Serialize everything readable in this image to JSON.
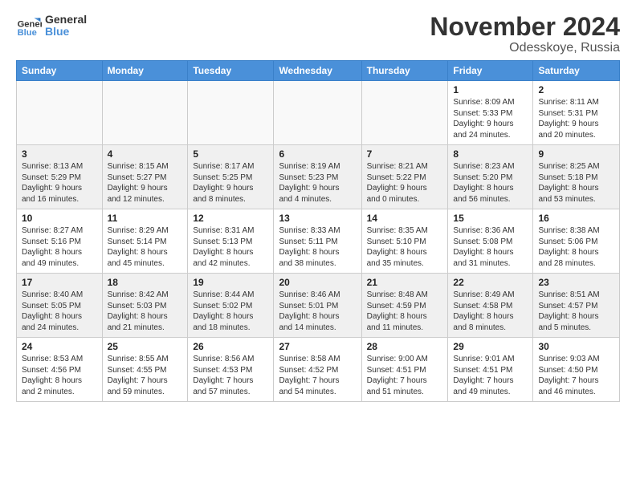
{
  "header": {
    "logo_general": "General",
    "logo_blue": "Blue",
    "title": "November 2024",
    "subtitle": "Odesskoye, Russia"
  },
  "days_of_week": [
    "Sunday",
    "Monday",
    "Tuesday",
    "Wednesday",
    "Thursday",
    "Friday",
    "Saturday"
  ],
  "weeks": [
    [
      {
        "day": "",
        "info": ""
      },
      {
        "day": "",
        "info": ""
      },
      {
        "day": "",
        "info": ""
      },
      {
        "day": "",
        "info": ""
      },
      {
        "day": "",
        "info": ""
      },
      {
        "day": "1",
        "info": "Sunrise: 8:09 AM\nSunset: 5:33 PM\nDaylight: 9 hours\nand 24 minutes."
      },
      {
        "day": "2",
        "info": "Sunrise: 8:11 AM\nSunset: 5:31 PM\nDaylight: 9 hours\nand 20 minutes."
      }
    ],
    [
      {
        "day": "3",
        "info": "Sunrise: 8:13 AM\nSunset: 5:29 PM\nDaylight: 9 hours\nand 16 minutes."
      },
      {
        "day": "4",
        "info": "Sunrise: 8:15 AM\nSunset: 5:27 PM\nDaylight: 9 hours\nand 12 minutes."
      },
      {
        "day": "5",
        "info": "Sunrise: 8:17 AM\nSunset: 5:25 PM\nDaylight: 9 hours\nand 8 minutes."
      },
      {
        "day": "6",
        "info": "Sunrise: 8:19 AM\nSunset: 5:23 PM\nDaylight: 9 hours\nand 4 minutes."
      },
      {
        "day": "7",
        "info": "Sunrise: 8:21 AM\nSunset: 5:22 PM\nDaylight: 9 hours\nand 0 minutes."
      },
      {
        "day": "8",
        "info": "Sunrise: 8:23 AM\nSunset: 5:20 PM\nDaylight: 8 hours\nand 56 minutes."
      },
      {
        "day": "9",
        "info": "Sunrise: 8:25 AM\nSunset: 5:18 PM\nDaylight: 8 hours\nand 53 minutes."
      }
    ],
    [
      {
        "day": "10",
        "info": "Sunrise: 8:27 AM\nSunset: 5:16 PM\nDaylight: 8 hours\nand 49 minutes."
      },
      {
        "day": "11",
        "info": "Sunrise: 8:29 AM\nSunset: 5:14 PM\nDaylight: 8 hours\nand 45 minutes."
      },
      {
        "day": "12",
        "info": "Sunrise: 8:31 AM\nSunset: 5:13 PM\nDaylight: 8 hours\nand 42 minutes."
      },
      {
        "day": "13",
        "info": "Sunrise: 8:33 AM\nSunset: 5:11 PM\nDaylight: 8 hours\nand 38 minutes."
      },
      {
        "day": "14",
        "info": "Sunrise: 8:35 AM\nSunset: 5:10 PM\nDaylight: 8 hours\nand 35 minutes."
      },
      {
        "day": "15",
        "info": "Sunrise: 8:36 AM\nSunset: 5:08 PM\nDaylight: 8 hours\nand 31 minutes."
      },
      {
        "day": "16",
        "info": "Sunrise: 8:38 AM\nSunset: 5:06 PM\nDaylight: 8 hours\nand 28 minutes."
      }
    ],
    [
      {
        "day": "17",
        "info": "Sunrise: 8:40 AM\nSunset: 5:05 PM\nDaylight: 8 hours\nand 24 minutes."
      },
      {
        "day": "18",
        "info": "Sunrise: 8:42 AM\nSunset: 5:03 PM\nDaylight: 8 hours\nand 21 minutes."
      },
      {
        "day": "19",
        "info": "Sunrise: 8:44 AM\nSunset: 5:02 PM\nDaylight: 8 hours\nand 18 minutes."
      },
      {
        "day": "20",
        "info": "Sunrise: 8:46 AM\nSunset: 5:01 PM\nDaylight: 8 hours\nand 14 minutes."
      },
      {
        "day": "21",
        "info": "Sunrise: 8:48 AM\nSunset: 4:59 PM\nDaylight: 8 hours\nand 11 minutes."
      },
      {
        "day": "22",
        "info": "Sunrise: 8:49 AM\nSunset: 4:58 PM\nDaylight: 8 hours\nand 8 minutes."
      },
      {
        "day": "23",
        "info": "Sunrise: 8:51 AM\nSunset: 4:57 PM\nDaylight: 8 hours\nand 5 minutes."
      }
    ],
    [
      {
        "day": "24",
        "info": "Sunrise: 8:53 AM\nSunset: 4:56 PM\nDaylight: 8 hours\nand 2 minutes."
      },
      {
        "day": "25",
        "info": "Sunrise: 8:55 AM\nSunset: 4:55 PM\nDaylight: 7 hours\nand 59 minutes."
      },
      {
        "day": "26",
        "info": "Sunrise: 8:56 AM\nSunset: 4:53 PM\nDaylight: 7 hours\nand 57 minutes."
      },
      {
        "day": "27",
        "info": "Sunrise: 8:58 AM\nSunset: 4:52 PM\nDaylight: 7 hours\nand 54 minutes."
      },
      {
        "day": "28",
        "info": "Sunrise: 9:00 AM\nSunset: 4:51 PM\nDaylight: 7 hours\nand 51 minutes."
      },
      {
        "day": "29",
        "info": "Sunrise: 9:01 AM\nSunset: 4:51 PM\nDaylight: 7 hours\nand 49 minutes."
      },
      {
        "day": "30",
        "info": "Sunrise: 9:03 AM\nSunset: 4:50 PM\nDaylight: 7 hours\nand 46 minutes."
      }
    ]
  ]
}
